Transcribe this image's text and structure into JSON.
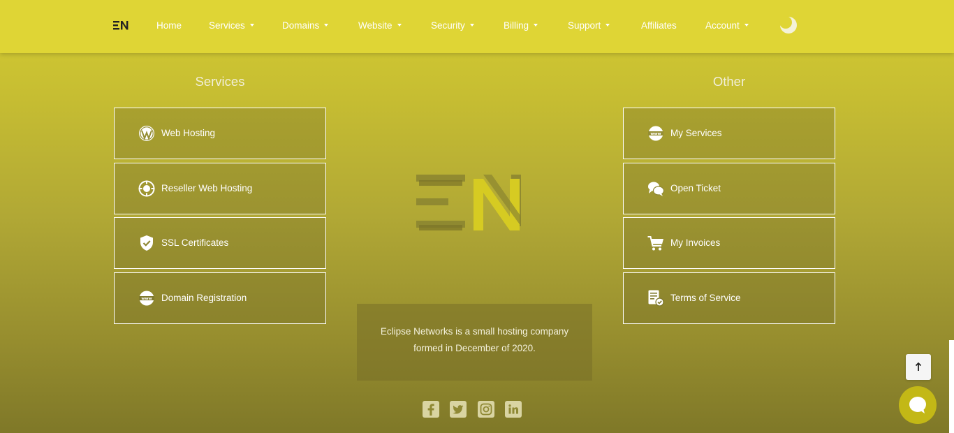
{
  "header": {
    "logo_text": "EN",
    "nav": [
      {
        "label": "Home",
        "dropdown": false
      },
      {
        "label": "Services",
        "dropdown": true
      },
      {
        "label": "Domains",
        "dropdown": true
      },
      {
        "label": "Website",
        "dropdown": true
      },
      {
        "label": "Security",
        "dropdown": true
      },
      {
        "label": "Billing",
        "dropdown": true
      },
      {
        "label": "Support",
        "dropdown": true
      },
      {
        "label": "Affiliates",
        "dropdown": false
      },
      {
        "label": "Account",
        "dropdown": true
      }
    ],
    "theme_toggle_icon": "moon-icon"
  },
  "services": {
    "title": "Services",
    "items": [
      {
        "label": "Web Hosting",
        "icon": "wordpress-icon"
      },
      {
        "label": "Reseller Web Hosting",
        "icon": "reseller-icon"
      },
      {
        "label": "SSL Certificates",
        "icon": "shield-check-icon"
      },
      {
        "label": "Domain Registration",
        "icon": "www-icon"
      }
    ]
  },
  "other": {
    "title": "Other",
    "items": [
      {
        "label": "My Services",
        "icon": "www-icon"
      },
      {
        "label": "Open Ticket",
        "icon": "chat-bubbles-icon"
      },
      {
        "label": "My Invoices",
        "icon": "cart-icon"
      },
      {
        "label": "Terms of Service",
        "icon": "document-check-icon"
      }
    ]
  },
  "about": {
    "text": "Eclipse Networks is a small hosting company formed in December of 2020."
  },
  "social": [
    "facebook-icon",
    "twitter-icon",
    "instagram-icon",
    "linkedin-icon"
  ],
  "colors": {
    "header_bg": "#dfd535",
    "accent": "#c3b816",
    "card_border": "#ffffff"
  }
}
